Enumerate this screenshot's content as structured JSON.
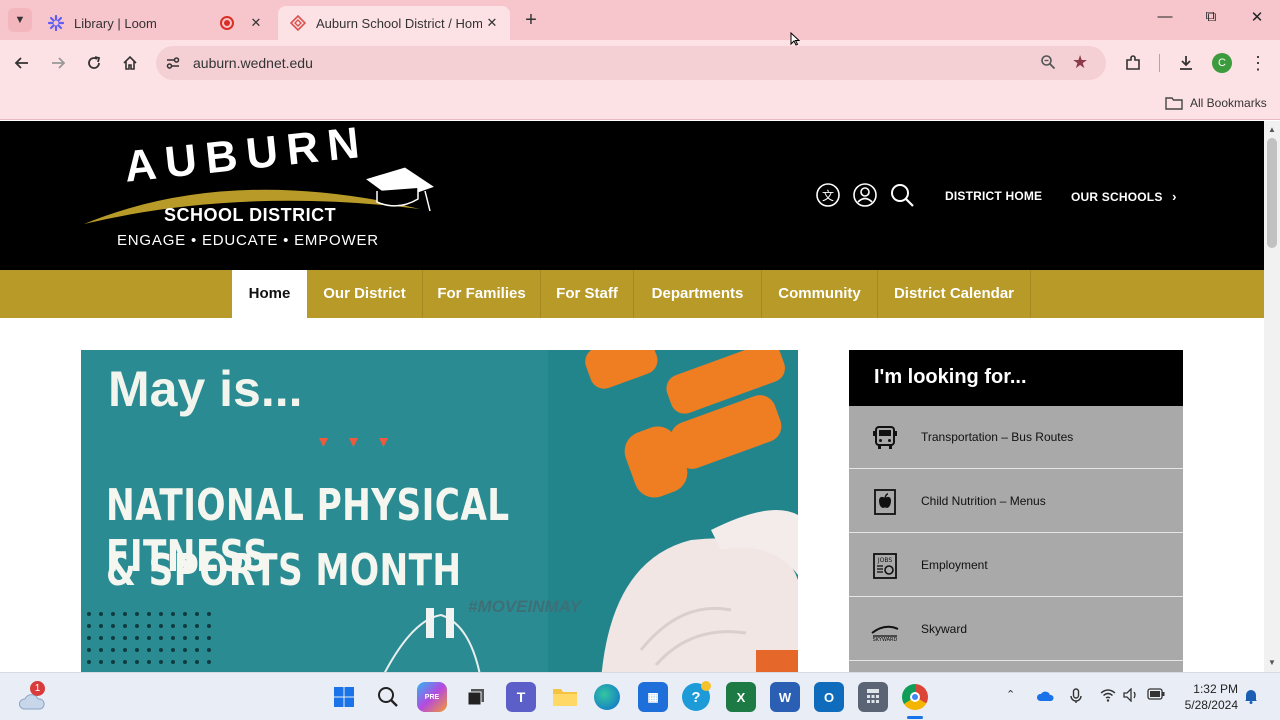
{
  "browser": {
    "tabs": [
      {
        "title": "Library | Loom",
        "active": false
      },
      {
        "title": "Auburn School District / Homep",
        "active": true
      }
    ],
    "url": "auburn.wednet.edu",
    "bookmarks_label": "All Bookmarks",
    "profile_initial": "C"
  },
  "site": {
    "logo": {
      "name": "AUBURN",
      "subtitle": "SCHOOL DISTRICT",
      "tagline": "ENGAGE • EDUCATE • EMPOWER"
    },
    "header_links": {
      "district_home": "DISTRICT HOME",
      "our_schools": "OUR SCHOOLS"
    },
    "nav": [
      "Home",
      "Our District",
      "For Families",
      "For Staff",
      "Departments",
      "Community",
      "District Calendar"
    ],
    "nav_active": "Home",
    "hero": {
      "line1": "May is...",
      "line2": "NATIONAL PHYSICAL FITNESS",
      "line3": "& SPORTS MONTH",
      "hashtag": "#MOVEINMAY"
    },
    "looking_for": {
      "title": "I'm looking for...",
      "items": [
        {
          "label": "Transportation – Bus Routes",
          "icon": "bus-icon"
        },
        {
          "label": "Child Nutrition – Menus",
          "icon": "apple-icon"
        },
        {
          "label": "Employment",
          "icon": "jobs-icon"
        },
        {
          "label": "Skyward",
          "icon": "skyward-icon"
        }
      ]
    },
    "colors": {
      "gold": "#b79a28",
      "black": "#000000",
      "panel_gray": "#a9a9a9"
    }
  },
  "taskbar": {
    "weather_badge": "1",
    "time": "1:32 PM",
    "date": "5/28/2024"
  }
}
